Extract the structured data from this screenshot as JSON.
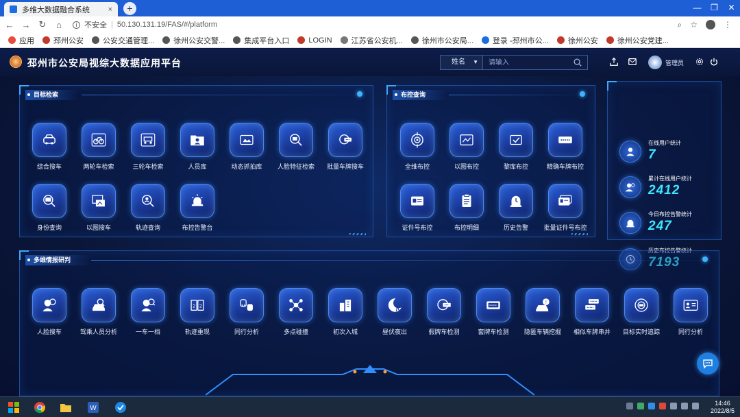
{
  "browser": {
    "tab_title": "多维大数据融合系统",
    "tab_close": "×",
    "new_tab": "+",
    "security_label": "不安全",
    "url": "50.130.131.19/FAS/#/platform",
    "bookmarks": [
      {
        "label": "应用",
        "color": "#e74c3c"
      },
      {
        "label": "邳州公安",
        "color": "#c0392b"
      },
      {
        "label": "公安交通管理...",
        "color": "#555"
      },
      {
        "label": "徐州公安交警...",
        "color": "#555"
      },
      {
        "label": "集成平台入口",
        "color": "#555"
      },
      {
        "label": "LOGIN",
        "color": "#c0392b"
      },
      {
        "label": "江苏省公安机...",
        "color": "#777"
      },
      {
        "label": "徐州市公安局...",
        "color": "#555"
      },
      {
        "label": "登录 -邳州市公...",
        "color": "#1a6ee0"
      },
      {
        "label": "徐州公安",
        "color": "#c0392b"
      },
      {
        "label": "徐州公安党建...",
        "color": "#c0392b"
      }
    ]
  },
  "header": {
    "title": "邳州市公安局视综大数据应用平台",
    "search_type": "姓名",
    "search_placeholder": "请输入",
    "admin_name": "管理员"
  },
  "panels": {
    "target_search": {
      "title": "目标检索",
      "items": [
        {
          "label": "综合搜车",
          "icon": "car-search-icon"
        },
        {
          "label": "两轮车检索",
          "icon": "bicycle-icon"
        },
        {
          "label": "三轮车检索",
          "icon": "tricycle-icon"
        },
        {
          "label": "人员库",
          "icon": "person-folder-icon"
        },
        {
          "label": "动态抓拍库",
          "icon": "camera-icon"
        },
        {
          "label": "人脸特征检索",
          "icon": "face-id-icon"
        },
        {
          "label": "批量车牌搜车",
          "icon": "plate-search-icon"
        },
        {
          "label": "身份查询",
          "icon": "id-search-icon"
        },
        {
          "label": "以图搜车",
          "icon": "image-search-icon"
        },
        {
          "label": "轨迹查询",
          "icon": "track-search-icon"
        },
        {
          "label": "布控告警台",
          "icon": "alarm-icon"
        }
      ]
    },
    "control": {
      "title": "布控查询",
      "items": [
        {
          "label": "全维布控",
          "icon": "target-icon"
        },
        {
          "label": "以图布控",
          "icon": "image-icon"
        },
        {
          "label": "黎库布控",
          "icon": "check-box-icon"
        },
        {
          "label": "精确车牌布控",
          "icon": "plate-icon"
        },
        {
          "label": "证件号布控",
          "icon": "id-card-icon"
        },
        {
          "label": "布控明细",
          "icon": "clipboard-icon"
        },
        {
          "label": "历史告警",
          "icon": "history-alarm-icon"
        },
        {
          "label": "批量证件号布控",
          "icon": "id-card-batch-icon"
        }
      ]
    },
    "stats": [
      {
        "label": "在线用户统计",
        "value": "7",
        "icon": "user-icon"
      },
      {
        "label": "累计在线用户统计",
        "value": "2412",
        "icon": "users-icon"
      },
      {
        "label": "今日布控告警统计",
        "value": "247",
        "icon": "alarm-bell-icon"
      },
      {
        "label": "历史布控告警统计",
        "value": "7193",
        "icon": "history-icon"
      }
    ],
    "analysis": {
      "title": "多维情报研判",
      "items": [
        {
          "label": "人脸搜车",
          "icon": "face-car-icon"
        },
        {
          "label": "驾乘人员分析",
          "icon": "driver-icon"
        },
        {
          "label": "一车一档",
          "icon": "car-file-icon"
        },
        {
          "label": "轨迹重现",
          "icon": "track-replay-icon"
        },
        {
          "label": "同行分析",
          "icon": "companion-icon"
        },
        {
          "label": "多点碰撞",
          "icon": "multi-point-icon"
        },
        {
          "label": "初次入城",
          "icon": "city-entry-icon"
        },
        {
          "label": "昼伏夜出",
          "icon": "night-icon"
        },
        {
          "label": "假牌车检测",
          "icon": "fake-plate-icon"
        },
        {
          "label": "套牌车检测",
          "icon": "clone-plate-icon"
        },
        {
          "label": "隐匿车辆挖掘",
          "icon": "hidden-car-icon"
        },
        {
          "label": "相似车牌串并",
          "icon": "similar-plate-icon"
        },
        {
          "label": "目标实时追踪",
          "icon": "realtime-track-icon"
        },
        {
          "label": "同行分析",
          "icon": "peer-analysis-icon"
        }
      ]
    }
  },
  "taskbar": {
    "time": "14:46",
    "date": "2022/8/5"
  }
}
